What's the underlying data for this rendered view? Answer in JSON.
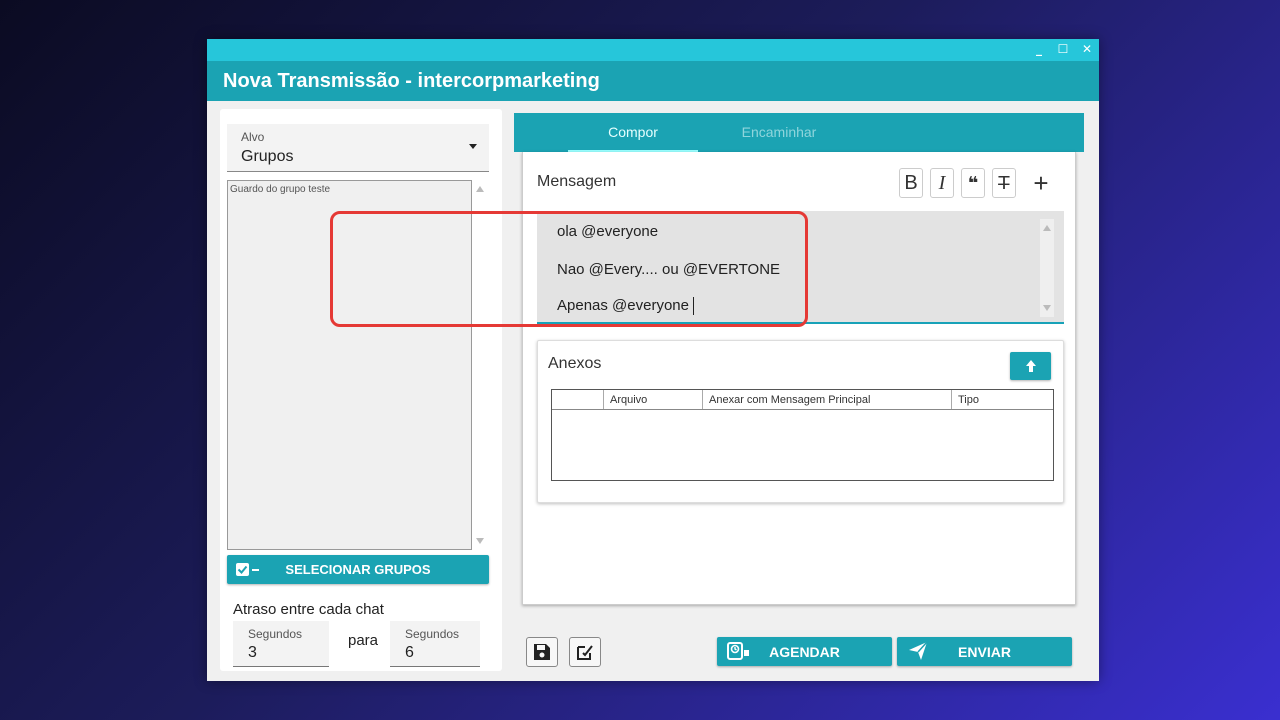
{
  "window": {
    "title": "Nova Transmissão - intercorpmarketing",
    "controls": [
      "minimize",
      "maximize",
      "close"
    ]
  },
  "left": {
    "alvo_label": "Alvo",
    "alvo_value": "Grupos",
    "group_list_hint": "Guardo do grupo teste",
    "select_groups_button": "SELECIONAR GRUPOS",
    "delay_label": "Atraso entre cada chat",
    "delay_from_label": "Segundos",
    "delay_from_value": "3",
    "delay_separator": "para",
    "delay_to_label": "Segundos",
    "delay_to_value": "6"
  },
  "tabs": [
    {
      "label": "Compor",
      "active": true
    },
    {
      "label": "Encaminhar",
      "active": false
    }
  ],
  "compose": {
    "message_label": "Mensagem",
    "format_buttons": [
      {
        "glyph": "B",
        "icon": "bold-icon"
      },
      {
        "glyph": "I",
        "icon": "italic-icon"
      },
      {
        "glyph": "❝",
        "icon": "quote-icon"
      },
      {
        "glyph": "T̶",
        "icon": "strikethrough-icon"
      }
    ],
    "plus": "+",
    "message_lines": [
      "ola @everyone",
      "Nao @Every.... ou @EVERTONE",
      "Apenas @everyone"
    ],
    "attachments_title": "Anexos",
    "attachments_columns": [
      "",
      "Arquivo",
      "Anexar com Mensagem Principal",
      "Tipo"
    ]
  },
  "footer": {
    "save_icon": "save-icon",
    "edit_icon": "edit-icon",
    "schedule_button": "AGENDAR",
    "send_button": "ENVIAR"
  },
  "colors": {
    "accent": "#1ba3b3",
    "titlebar_top": "#26c6da",
    "highlight": "#e53935"
  }
}
